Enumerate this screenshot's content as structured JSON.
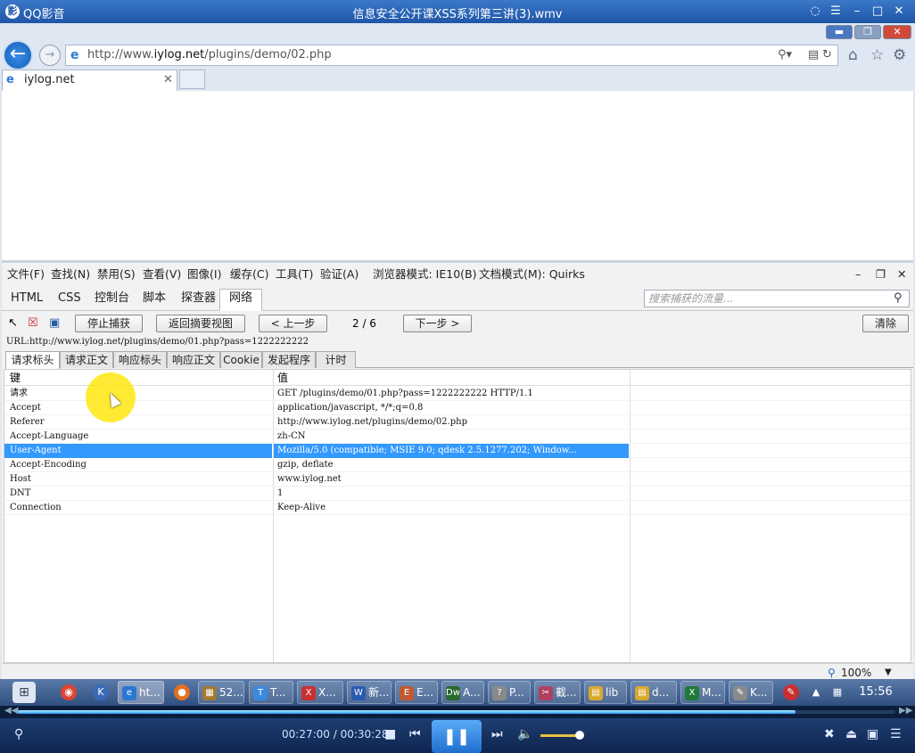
{
  "player": {
    "app_name": "QQ影音",
    "video_title": "信息安全公开课XSS系列第三讲(3).wmv",
    "time_current": "00:27:00",
    "time_sep": " / ",
    "time_total": "00:30:28",
    "progress": 0.886
  },
  "browser": {
    "address_prefix": "http://www.",
    "address_domain": "iylog.net",
    "address_suffix": "/plugins/demo/02.php",
    "tab_title": "iylog.net"
  },
  "devtools": {
    "menus": [
      "文件(F)",
      "查找(N)",
      "禁用(S)",
      "查看(V)",
      "图像(I)",
      "缓存(C)",
      "工具(T)",
      "验证(A)",
      "浏览器模式: IE10(B)",
      "文档模式(M): Quirks"
    ],
    "tabs": [
      "HTML",
      "CSS",
      "控制台",
      "脚本",
      "探查器",
      "网络"
    ],
    "active_tab": "网络",
    "search_placeholder": "搜索捕获的流量...",
    "stop_capture": "停止捕获",
    "back_summary": "返回摘要视图",
    "prev": "< 上一步",
    "page_indicator": "2 / 6",
    "next": "下一步 >",
    "clear": "清除",
    "url_line": "URL:http://www.iylog.net/plugins/demo/01.php?pass=1222222222",
    "subtabs": [
      "请求标头",
      "请求正文",
      "响应标头",
      "响应正文",
      "Cookie",
      "发起程序",
      "计时"
    ],
    "col_key": "键",
    "col_value": "值",
    "rows": [
      {
        "key": "请求",
        "value": "GET /plugins/demo/01.php?pass=1222222222 HTTP/1.1"
      },
      {
        "key": "Accept",
        "value": "application/javascript, */*;q=0.8"
      },
      {
        "key": "Referer",
        "value": "http://www.iylog.net/plugins/demo/02.php"
      },
      {
        "key": "Accept-Language",
        "value": "zh-CN"
      },
      {
        "key": "User-Agent",
        "value": "Mozilla/5.0 (compatible; MSIE 9.0; qdesk 2.5.1277.202; Window..."
      },
      {
        "key": "Accept-Encoding",
        "value": "gzip, deflate"
      },
      {
        "key": "Host",
        "value": "www.iylog.net"
      },
      {
        "key": "DNT",
        "value": "1"
      },
      {
        "key": "Connection",
        "value": "Keep-Alive"
      }
    ],
    "selected_row": 4,
    "zoom": "100%"
  },
  "taskbar": {
    "items": [
      "ht...",
      "52...",
      "T...",
      "X...",
      "新...",
      "E...",
      "A...",
      "P...",
      "截...",
      "lib",
      "d...",
      "M...",
      "K..."
    ],
    "clock": "15:56"
  }
}
